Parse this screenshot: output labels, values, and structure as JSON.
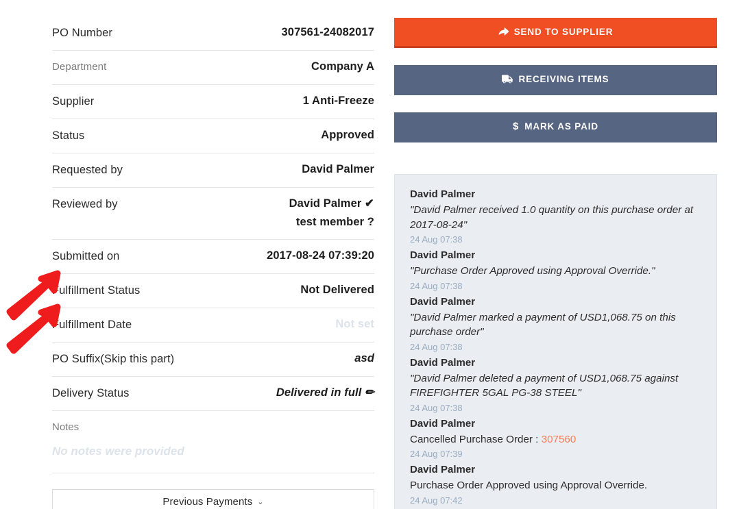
{
  "details": {
    "rows": [
      {
        "label": "PO Number",
        "value": "307561-24082017",
        "label_style": "normal",
        "value_style": "normal"
      },
      {
        "label": "Department",
        "value": "Company A",
        "label_style": "muted",
        "value_style": "normal"
      },
      {
        "label": "Supplier",
        "value": "1 Anti-Freeze",
        "label_style": "normal",
        "value_style": "normal"
      },
      {
        "label": "Status",
        "value": "Approved",
        "label_style": "normal",
        "value_style": "normal"
      },
      {
        "label": "Requested by",
        "value": "David Palmer",
        "label_style": "normal",
        "value_style": "normal"
      },
      {
        "label": "Reviewed by",
        "value": "David Palmer ✔",
        "value2": "test member ?",
        "label_style": "normal",
        "value_style": "normal"
      },
      {
        "label": "Submitted on",
        "value": "2017-08-24 07:39:20",
        "label_style": "normal",
        "value_style": "normal"
      },
      {
        "label": "Fulfillment Status",
        "value": "Not Delivered",
        "label_style": "normal",
        "value_style": "normal"
      },
      {
        "label": "Fulfillment Date",
        "value": "Not set",
        "label_style": "normal",
        "value_style": "faded"
      },
      {
        "label": "PO Suffix(Skip this part)",
        "value": "asd",
        "label_style": "normal",
        "value_style": "italic"
      },
      {
        "label": "Delivery Status",
        "value": "Delivered in full ✏",
        "label_style": "normal",
        "value_style": "italic"
      }
    ],
    "notes": {
      "label": "Notes",
      "empty_text": "No notes were provided"
    },
    "previous_payments": {
      "label": "Previous Payments",
      "chevron": "chevron-down-icon"
    }
  },
  "actions": [
    {
      "label": "SEND TO SUPPLIER",
      "icon": "share-arrow-icon",
      "style": "primary",
      "color": "#f04e23"
    },
    {
      "label": "RECEIVING ITEMS",
      "icon": "truck-icon",
      "style": "secondary",
      "color": "#566582"
    },
    {
      "label": "MARK AS PAID",
      "icon": "dollar-icon",
      "style": "secondary",
      "color": "#566582"
    }
  ],
  "activity": {
    "events": [
      {
        "user": "David Palmer",
        "text": "\"David Palmer received 1.0 quantity on this purchase order at 2017-08-24\"",
        "style": "quoted",
        "time": "24 Aug 07:38"
      },
      {
        "user": "David Palmer",
        "text": "\"Purchase Order Approved using Approval Override.\"",
        "style": "quoted",
        "time": "24 Aug 07:38"
      },
      {
        "user": "David Palmer",
        "text": "\"David Palmer marked a payment of USD1,068.75 on this purchase order\"",
        "style": "quoted",
        "time": "24 Aug 07:38"
      },
      {
        "user": "David Palmer",
        "text": "\"David Palmer deleted a payment of USD1,068.75 against FIREFIGHTER 5GAL PG-38 STEEL\"",
        "style": "quoted",
        "time": "24 Aug 07:38"
      },
      {
        "user": "David Palmer",
        "text": "Cancelled Purchase Order : ",
        "link": "307560",
        "style": "plain",
        "time": "24 Aug 07:39"
      },
      {
        "user": "David Palmer",
        "text": "Purchase Order Approved using Approval Override.",
        "style": "plain",
        "time": "24 Aug 07:42"
      }
    ]
  },
  "annotations": {
    "arrows": [
      {
        "name": "arrow-fulfillment-status",
        "target": "Fulfillment Status",
        "color": "#ee1c1c"
      },
      {
        "name": "arrow-fulfillment-date",
        "target": "Fulfillment Date",
        "color": "#ee1c1c"
      }
    ]
  }
}
